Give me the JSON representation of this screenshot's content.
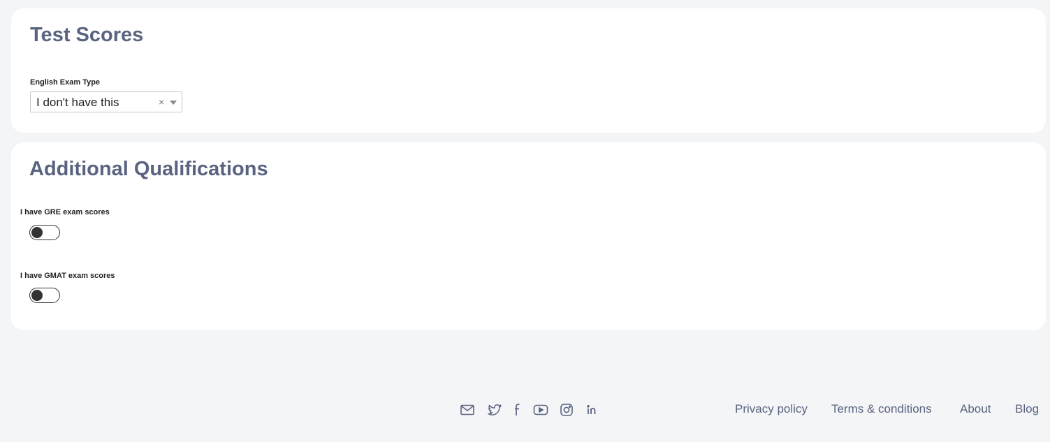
{
  "test_scores": {
    "title": "Test Scores",
    "english_exam_label": "English Exam Type",
    "english_exam_value": "I don't have this",
    "clear_symbol": "×"
  },
  "additional_qualifications": {
    "title": "Additional Qualifications",
    "toggles": [
      {
        "label": "I have GRE exam scores",
        "checked": false
      },
      {
        "label": "I have GMAT exam scores",
        "checked": false
      }
    ]
  },
  "footer": {
    "social_icons": [
      "mail-icon",
      "twitter-icon",
      "facebook-icon",
      "youtube-icon",
      "instagram-icon",
      "linkedin-icon"
    ],
    "links": [
      "Privacy policy",
      "Terms & conditions",
      "About",
      "Blog"
    ]
  },
  "colors": {
    "background": "#f4f5f7",
    "card": "#ffffff",
    "heading": "#5a6480",
    "footer_text": "#5a6480"
  }
}
